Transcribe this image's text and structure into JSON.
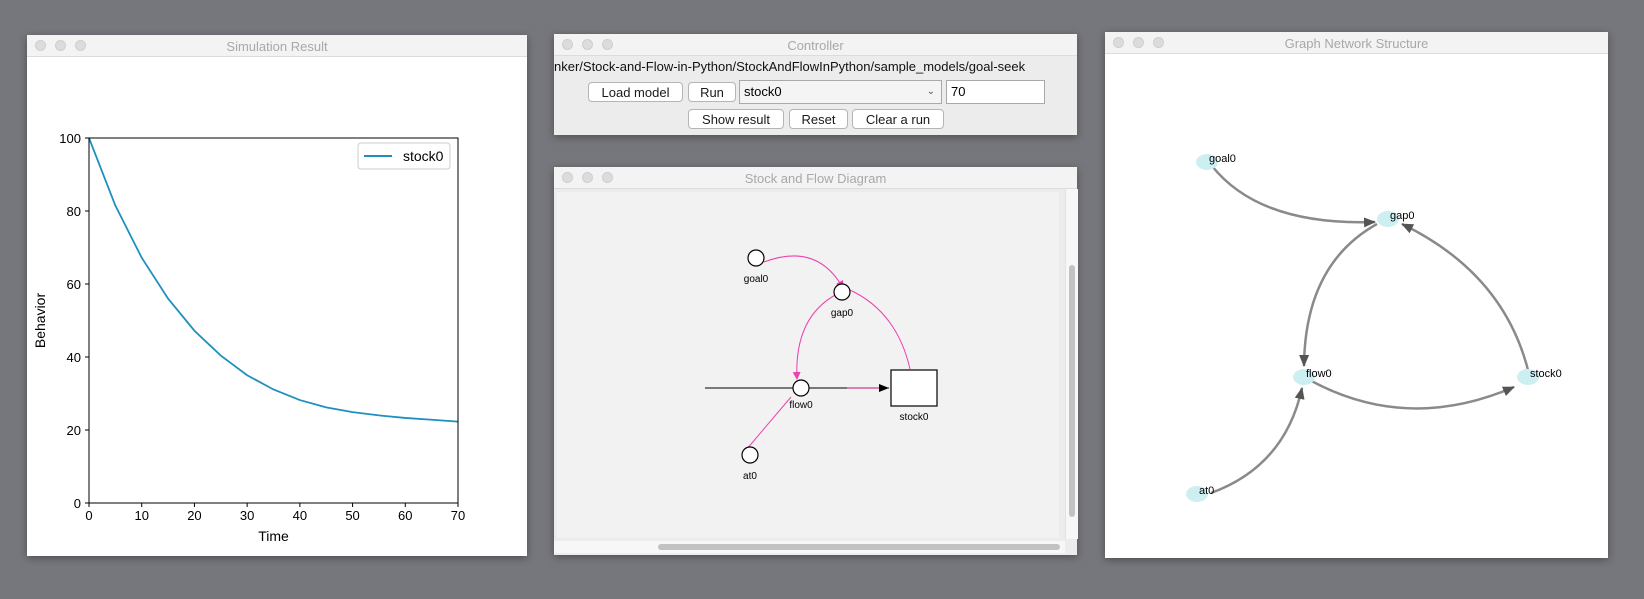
{
  "windows": {
    "simulation": {
      "title": "Simulation Result"
    },
    "controller": {
      "title": "Controller"
    },
    "diagram": {
      "title": "Stock and Flow Diagram"
    },
    "graph": {
      "title": "Graph Network Structure"
    }
  },
  "controller": {
    "path": "nker/Stock-and-Flow-in-Python/StockAndFlowInPython/sample_models/goal-seek",
    "load_model_label": "Load model",
    "run_label": "Run",
    "variable_select": "stock0",
    "run_length_value": "70",
    "show_result_label": "Show result",
    "reset_label": "Reset",
    "clear_run_label": "Clear a run"
  },
  "diagram": {
    "labels": {
      "goal": "goal0",
      "gap": "gap0",
      "flow": "flow0",
      "stock": "stock0",
      "at": "at0"
    }
  },
  "graph": {
    "nodes": {
      "goal": "goal0",
      "gap": "gap0",
      "flow": "flow0",
      "stock": "stock0",
      "at": "at0"
    }
  },
  "chart_data": {
    "type": "line",
    "title": "",
    "xlabel": "Time",
    "ylabel": "Behavior",
    "xlim": [
      0,
      70
    ],
    "ylim": [
      0,
      100
    ],
    "x_ticks": [
      0,
      10,
      20,
      30,
      40,
      50,
      60,
      70
    ],
    "y_ticks": [
      0,
      20,
      40,
      60,
      80,
      100
    ],
    "legend": "top-right",
    "grid": false,
    "series": [
      {
        "name": "stock0",
        "color": "#1f8fbf",
        "x": [
          0,
          5,
          10,
          15,
          20,
          25,
          30,
          35,
          40,
          45,
          50,
          55,
          60,
          65,
          70
        ],
        "values": [
          100,
          81.5,
          67.2,
          56.0,
          47.2,
          40.4,
          35.0,
          31.1,
          28.2,
          26.2,
          24.9,
          24.0,
          23.3,
          22.8,
          22.3
        ]
      }
    ]
  }
}
